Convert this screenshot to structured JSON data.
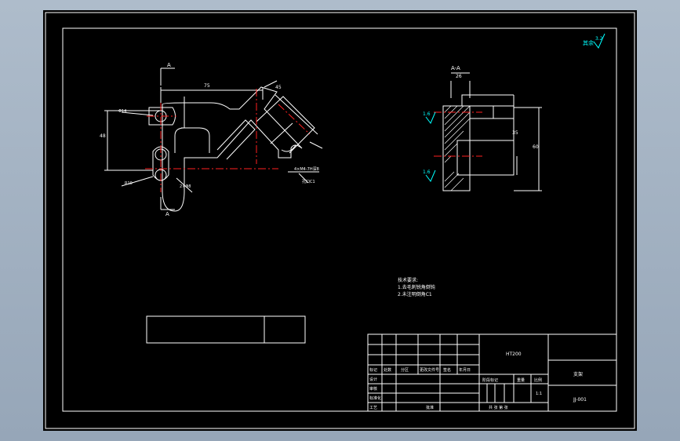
{
  "colors": {
    "background": "#a6b5c6",
    "sheet": "#000000",
    "line": "#ffffff",
    "center_line": "#ff2020",
    "annotation": "#00ffff"
  },
  "drawing": {
    "roughness": "其余",
    "roughness_value": "3.2",
    "section_label": "A-A",
    "view_arrow_label": "A",
    "surface_1": "1.6",
    "surface_2": "1.6",
    "notes": {
      "title": "技术要求:",
      "line1": "1.去毛刺锐角倒钝",
      "line2": "2.未注明倒角C1"
    },
    "title_block": {
      "material": "HT200",
      "mark": "标记",
      "count": "处数",
      "zone": "分区",
      "change_doc": "更改文件号",
      "sign": "签名",
      "date": "年月日",
      "design": "设计",
      "review": "审核",
      "process": "工艺",
      "standard": "标准化",
      "approve": "批准",
      "stage": "阶段标记",
      "weight": "重量",
      "scale": "比例",
      "scale_value": "1:1",
      "sheets": "共 张 第 张",
      "name": "支架",
      "code": "JJ-001"
    }
  }
}
